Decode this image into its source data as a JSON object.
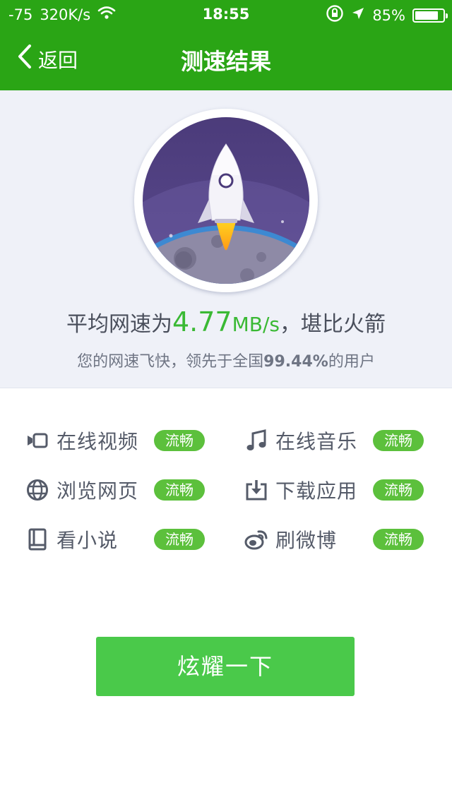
{
  "status_bar": {
    "signal": "-75",
    "network_speed": "320K/s",
    "time": "18:55",
    "battery_percent": "85%",
    "battery_level": 0.85,
    "icons": [
      "wifi-icon",
      "rotation-lock-icon",
      "location-arrow-icon",
      "battery-icon"
    ]
  },
  "nav": {
    "back_label": "返回",
    "title": "测速结果"
  },
  "result": {
    "prefix": "平均网速为",
    "speed_value": "4.77",
    "speed_unit": "MB/s",
    "suffix": "，堪比火箭",
    "sub_prefix": "您的网速飞快，领先于全国",
    "percentile": "99.44%",
    "sub_suffix": "的用户",
    "badge_icon": "rocket-icon"
  },
  "activities": [
    {
      "label": "在线视频",
      "status": "流畅",
      "icon": "video-icon"
    },
    {
      "label": "在线音乐",
      "status": "流畅",
      "icon": "music-note-icon"
    },
    {
      "label": "浏览网页",
      "status": "流畅",
      "icon": "globe-icon"
    },
    {
      "label": "下载应用",
      "status": "流畅",
      "icon": "download-icon"
    },
    {
      "label": "看小说",
      "status": "流畅",
      "icon": "book-icon"
    },
    {
      "label": "刷微博",
      "status": "流畅",
      "icon": "weibo-icon"
    }
  ],
  "cta": {
    "label": "炫耀一下"
  },
  "colors": {
    "header_green": "#2aa515",
    "accent_green": "#3ab934",
    "pill_green": "#5cc03c",
    "button_green": "#4ac94a",
    "hero_bg": "#eff1f8",
    "badge_purple": "#4b3b7a"
  }
}
